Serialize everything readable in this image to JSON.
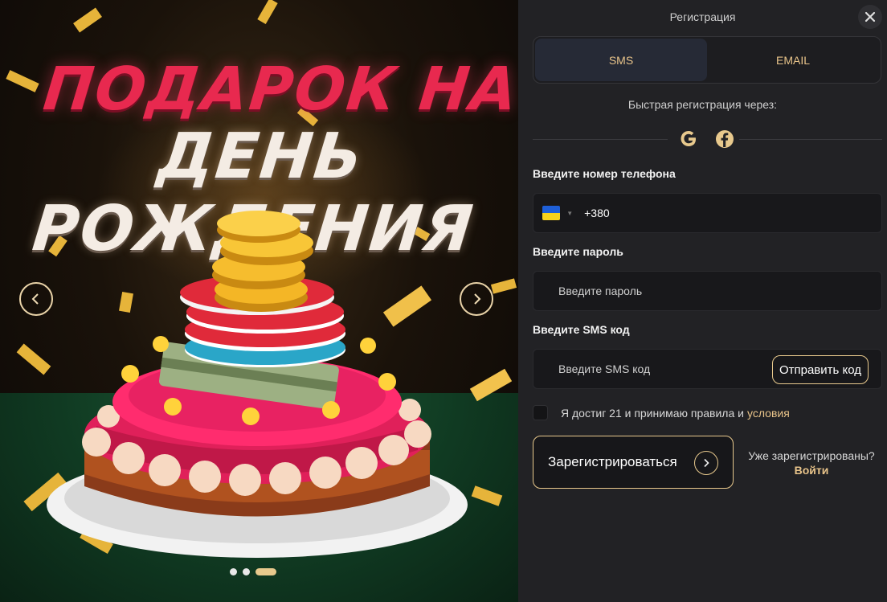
{
  "promo": {
    "title_line1": "ПОДАРОК НА",
    "title_line2": "ДЕНЬ РОЖДЕНИЯ",
    "slides_count": 3,
    "active_slide": 3
  },
  "form": {
    "title": "Регистрация",
    "tabs": [
      {
        "label": "SMS",
        "active": true
      },
      {
        "label": "EMAIL",
        "active": false
      }
    ],
    "quick_registration": "Быстрая регистрация через:",
    "social_icons": [
      "google-icon",
      "facebook-icon"
    ],
    "phone": {
      "label": "Введите номер телефона",
      "value": "+380",
      "country_icon": "ukraine-flag-icon"
    },
    "password": {
      "label": "Введите пароль",
      "placeholder": "Введите пароль"
    },
    "sms": {
      "label": "Введите SMS код",
      "placeholder": "Введите SMS код",
      "send_button": "Отправить код"
    },
    "agree_text": "Я достиг 21 и принимаю правила и",
    "agree_link": "условия",
    "register_button": "Зарегистрироваться",
    "already_registered": "Уже зарегистрированы?",
    "login_link": "Войти"
  },
  "colors": {
    "accent": "#e9c48a",
    "panel_bg": "#222225",
    "field_bg": "#18181b",
    "promo_red": "#e8294f"
  }
}
